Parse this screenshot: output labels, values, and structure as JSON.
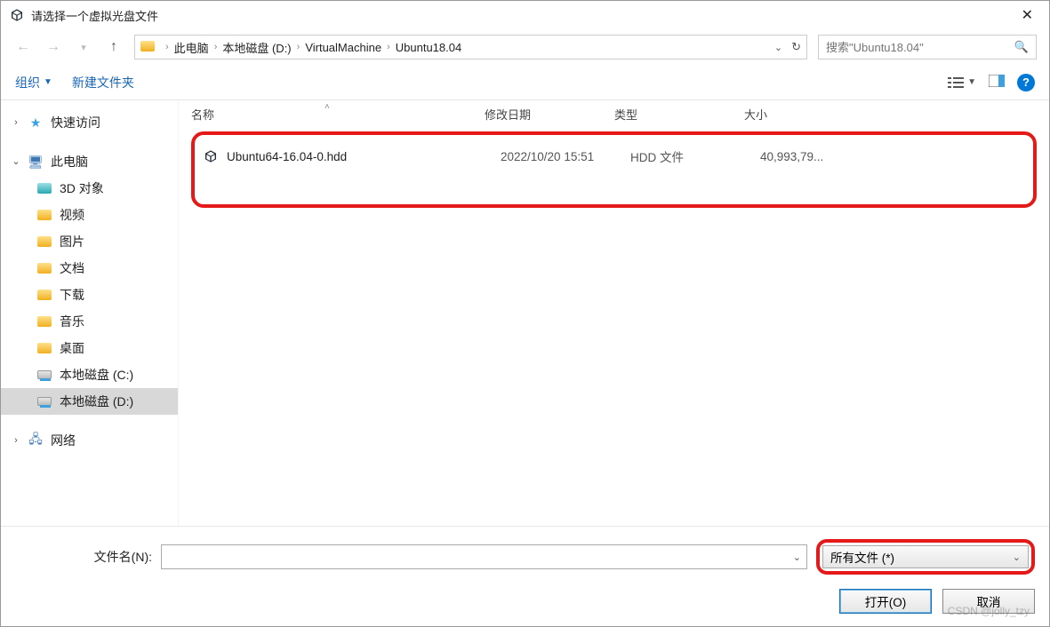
{
  "title": "请选择一个虚拟光盘文件",
  "breadcrumb": {
    "items": [
      "此电脑",
      "本地磁盘 (D:)",
      "VirtualMachine",
      "Ubuntu18.04"
    ]
  },
  "search": {
    "placeholder": "搜索\"Ubuntu18.04\""
  },
  "actionbar": {
    "organize": "组织",
    "newfolder": "新建文件夹"
  },
  "sidebar": {
    "quick_access": "快速访问",
    "this_pc": "此电脑",
    "children": [
      {
        "label": "3D 对象"
      },
      {
        "label": "视频"
      },
      {
        "label": "图片"
      },
      {
        "label": "文档"
      },
      {
        "label": "下载"
      },
      {
        "label": "音乐"
      },
      {
        "label": "桌面"
      },
      {
        "label": "本地磁盘 (C:)"
      },
      {
        "label": "本地磁盘 (D:)"
      }
    ],
    "network": "网络"
  },
  "columns": {
    "name": "名称",
    "date": "修改日期",
    "type": "类型",
    "size": "大小"
  },
  "files": [
    {
      "name": "Ubuntu64-16.04-0.hdd",
      "date": "2022/10/20 15:51",
      "type": "HDD 文件",
      "size": "40,993,79..."
    }
  ],
  "footer": {
    "filename_label": "文件名(N):",
    "filetype": "所有文件 (*)",
    "open": "打开(O)",
    "cancel": "取消"
  },
  "watermark": "CSDN @jolly_tzy"
}
